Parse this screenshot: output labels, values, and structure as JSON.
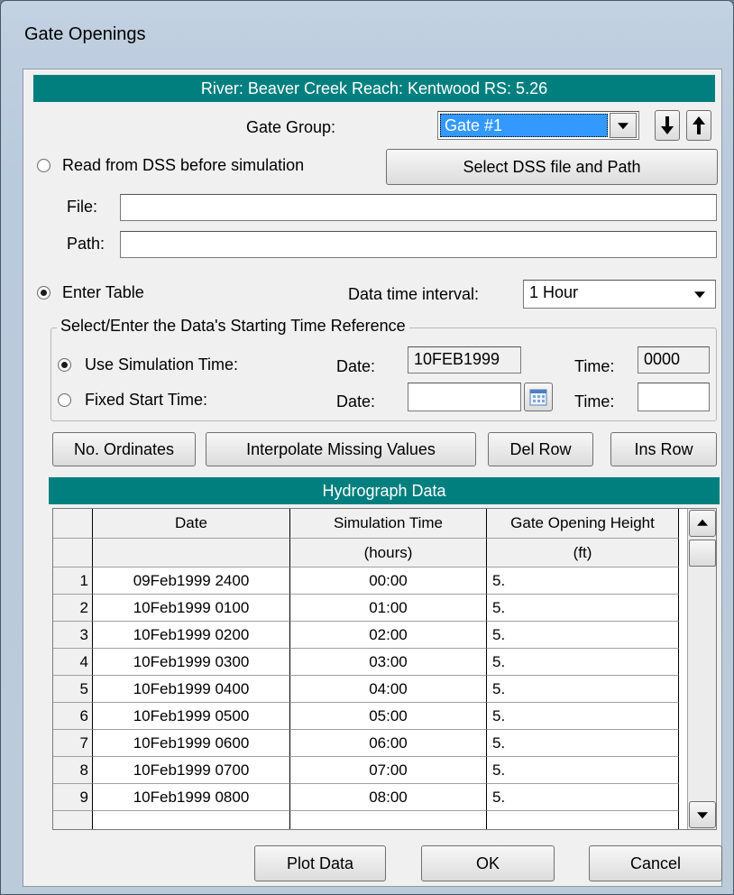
{
  "window": {
    "title": "Gate Openings"
  },
  "header_bar": "River: Beaver Creek  Reach: Kentwood  RS: 5.26",
  "gate_group": {
    "label": "Gate Group:",
    "value": "Gate #1"
  },
  "dss": {
    "radio_label": "Read from DSS before simulation",
    "select_button": "Select DSS file and Path",
    "file_label": "File:",
    "file_value": "",
    "path_label": "Path:",
    "path_value": ""
  },
  "enter_table": {
    "radio_label": "Enter Table"
  },
  "interval": {
    "label": "Data time interval:",
    "value": "1 Hour"
  },
  "start_ref": {
    "group_title": "Select/Enter the Data's Starting Time Reference",
    "sim_label": "Use Simulation Time:",
    "fixed_label": "Fixed Start Time:",
    "date_label": "Date:",
    "time_label": "Time:",
    "sim_date": "10FEB1999",
    "sim_time": "0000",
    "fixed_date": "",
    "fixed_time": ""
  },
  "buttons": {
    "no_ordinates": "No. Ordinates",
    "interpolate": "Interpolate Missing Values",
    "del_row": "Del Row",
    "ins_row": "Ins Row",
    "plot": "Plot Data",
    "ok": "OK",
    "cancel": "Cancel"
  },
  "hydro": {
    "title": "Hydrograph Data",
    "columns": [
      "Date",
      "Simulation Time",
      "Gate Opening Height"
    ],
    "units": [
      "",
      "(hours)",
      "(ft)"
    ],
    "rows": [
      {
        "n": "1",
        "date": "09Feb1999 2400",
        "time": "00:00",
        "h": "5."
      },
      {
        "n": "2",
        "date": "10Feb1999 0100",
        "time": "01:00",
        "h": "5."
      },
      {
        "n": "3",
        "date": "10Feb1999 0200",
        "time": "02:00",
        "h": "5."
      },
      {
        "n": "4",
        "date": "10Feb1999 0300",
        "time": "03:00",
        "h": "5."
      },
      {
        "n": "5",
        "date": "10Feb1999 0400",
        "time": "04:00",
        "h": "5."
      },
      {
        "n": "6",
        "date": "10Feb1999 0500",
        "time": "05:00",
        "h": "5."
      },
      {
        "n": "7",
        "date": "10Feb1999 0600",
        "time": "06:00",
        "h": "5."
      },
      {
        "n": "8",
        "date": "10Feb1999 0700",
        "time": "07:00",
        "h": "5."
      },
      {
        "n": "9",
        "date": "10Feb1999 0800",
        "time": "08:00",
        "h": "5."
      }
    ]
  }
}
